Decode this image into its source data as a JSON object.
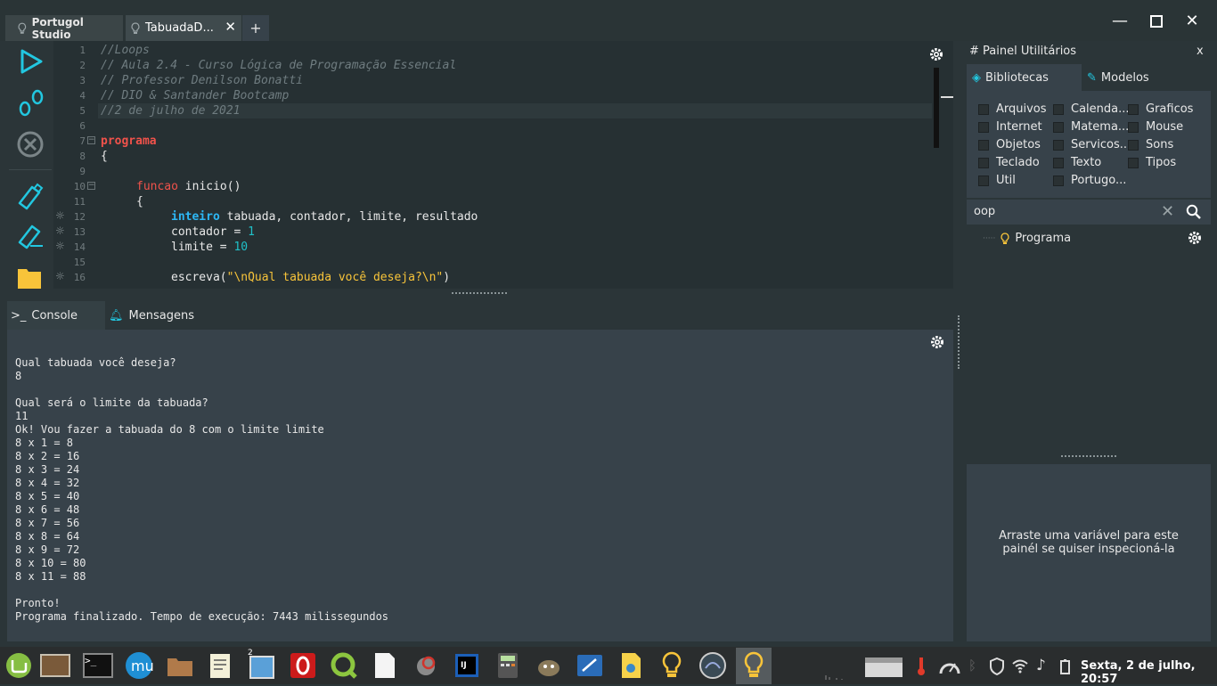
{
  "window": {
    "tabs": [
      {
        "label": "Portugol Studio"
      },
      {
        "label": "TabuadaD..."
      }
    ],
    "add_tab": "+",
    "controls": {
      "minimize": "—",
      "maximize": "☐",
      "close": "✕"
    }
  },
  "editor": {
    "line_numbers": [
      "1",
      "2",
      "3",
      "4",
      "5",
      "6",
      "7",
      "8",
      "9",
      "10",
      "11",
      "12",
      "13",
      "14",
      "15",
      "16"
    ],
    "lines": {
      "l1": "//Loops",
      "l2": "// Aula 2.4 - Curso Lógica de Programação Essencial",
      "l3": "// Professor Denilson Bonatti",
      "l4": "// DIO & Santander Bootcamp",
      "l5": "//2 de julho de 2021",
      "l7_kw": "programa",
      "l8": "{",
      "l10_kw": "funcao",
      "l10_rest": " inicio()",
      "l11": "{",
      "l12_type": "inteiro",
      "l12_rest": " tabuada, contador, limite, resultado",
      "l13_pre": "contador = ",
      "l13_num": "1",
      "l14_pre": "limite = ",
      "l14_num": "10",
      "l16_pre": "escreva(",
      "l16_str": "\"\\nQual tabuada você deseja?\\n\"",
      "l16_post": ")"
    }
  },
  "console": {
    "tab_label": "Console",
    "messages_label": "Mensagens",
    "output": "Qual tabuada você deseja?\n8\n\nQual será o limite da tabuada?\n11\nOk! Vou fazer a tabuada do 8 com o limite limite\n8 x 1 = 8\n8 x 2 = 16\n8 x 3 = 24\n8 x 4 = 32\n8 x 5 = 40\n8 x 6 = 48\n8 x 7 = 56\n8 x 8 = 64\n8 x 9 = 72\n8 x 10 = 80\n8 x 11 = 88\n\nPronto!\nPrograma finalizado. Tempo de execução: 7443 milissegundos"
  },
  "panel": {
    "title": "# Painel Utilitários",
    "close": "x",
    "tab_bibliotecas": "Bibliotecas",
    "tab_modelos": "Modelos",
    "libraries": [
      "Arquivos",
      "Calenda...",
      "Graficos",
      "Internet",
      "Matema...",
      "Mouse",
      "Objetos",
      "Servicos...",
      "Sons",
      "Teclado",
      "Texto",
      "Tipos",
      "Util",
      "Portugo..."
    ],
    "search_value": "oop",
    "tree_item": "Programa",
    "inspector_hint": "Arraste uma variável para este painél se quiser inspecioná-la"
  },
  "taskbar": {
    "badge": "2",
    "clock": "Sexta, 2 de julho, 20:57"
  },
  "colors": {
    "keyword": "#f0524b",
    "type": "#2db7f5",
    "number": "#20c0c8",
    "string": "#f8c43a",
    "comment": "#6f7c80",
    "accent": "#22c7e0"
  }
}
